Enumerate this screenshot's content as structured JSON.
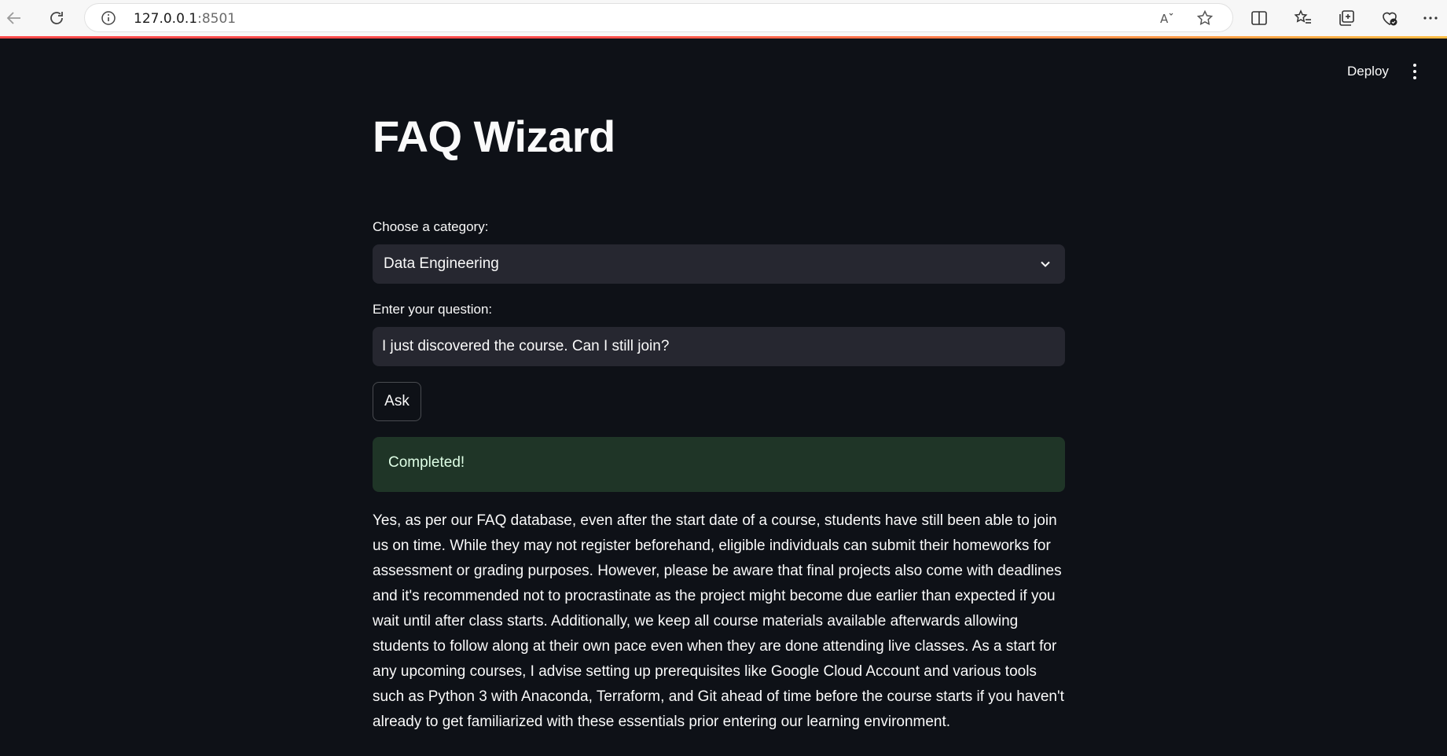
{
  "browser": {
    "url_host": "127.0.0.1",
    "url_port": ":8501",
    "icons": [
      "back-arrow-icon",
      "refresh-icon",
      "info-icon",
      "read-aloud-icon",
      "favorite-star-icon",
      "split-screen-icon",
      "favorites-icon",
      "collections-icon",
      "browser-essentials-icon",
      "more-options-icon"
    ]
  },
  "header": {
    "deploy_label": "Deploy",
    "menu_icon": "kebab-menu-icon"
  },
  "main": {
    "title": "FAQ Wizard",
    "category_label": "Choose a category:",
    "category_value": "Data Engineering",
    "question_label": "Enter your question:",
    "question_value": "I just discovered the course. Can I still join?",
    "ask_label": "Ask",
    "status_message": "Completed!",
    "answer": "Yes, as per our FAQ database, even after the start date of a course, students have still been able to join us on time. While they may not register beforehand, eligible individuals can submit their homeworks for assessment or grading purposes. However, please be aware that final projects also come with deadlines and it's recommended not to procrastinate as the project might become due earlier than expected if you wait until after class starts. Additionally, we keep all course materials available afterwards allowing students to follow along at their own pace even when they are done attending live classes. As a start for any upcoming courses, I advise setting up prerequisites like Google Cloud Account and various tools such as Python 3 with Anaconda, Terraform, and Git ahead of time before the course starts if you haven't already to get familiarized with these essentials prior entering our learning environment."
  },
  "colors": {
    "background": "#0e1117",
    "widget_bg": "#262730",
    "success_bg": "#1f3527",
    "accent": "#ff4b4b"
  }
}
